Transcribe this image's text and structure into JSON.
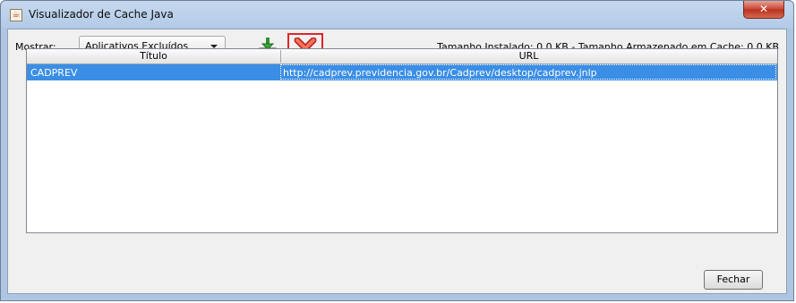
{
  "window": {
    "title": "Visualizador de Cache Java",
    "close_glyph": "✕",
    "app_icon": "java-cup-icon"
  },
  "toolbar": {
    "show_label": "Mostrar:",
    "show_selected": "Aplicativos Excluídos",
    "install_icon": "install-download-icon",
    "remove_icon": "remove-x-icon",
    "size_info": "Tamanho Instalado: 0.0 KB - Tamanho Armazenado em Cache: 0.0 KB"
  },
  "table": {
    "columns": [
      "Título",
      "URL"
    ],
    "rows": [
      {
        "titulo": "CADPREV",
        "url": "http://cadprev.previdencia.gov.br/Cadprev/desktop/cadprev.jnlp",
        "selected": true
      }
    ]
  },
  "footer": {
    "close_label": "Fechar"
  },
  "colors": {
    "selection": "#3a8ee6",
    "highlight_box": "#e2232a",
    "title_bar": "#b3cbe7"
  }
}
